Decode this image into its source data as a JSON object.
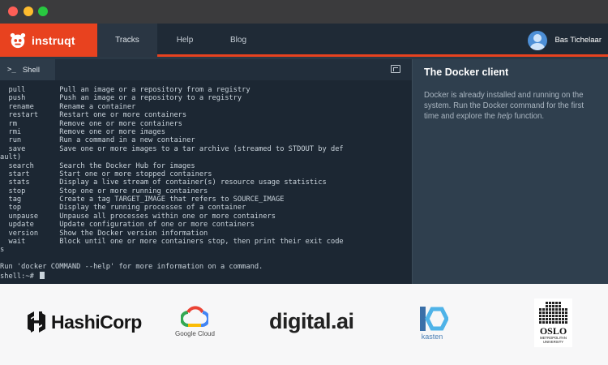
{
  "window": {
    "controls": [
      "close",
      "minimize",
      "maximize"
    ]
  },
  "navbar": {
    "brand": "instruqt",
    "tabs": [
      {
        "label": "Tracks",
        "active": true
      },
      {
        "label": "Help",
        "active": false
      },
      {
        "label": "Blog",
        "active": false
      }
    ],
    "user_name": "Bas Tichelaar",
    "accent_color": "#e8421f"
  },
  "shell": {
    "tab_label": "Shell",
    "prompt_glyph": ">_",
    "lines": [
      "  pull        Pull an image or a repository from a registry",
      "  push        Push an image or a repository to a registry",
      "  rename      Rename a container",
      "  restart     Restart one or more containers",
      "  rm          Remove one or more containers",
      "  rmi         Remove one or more images",
      "  run         Run a command in a new container",
      "  save        Save one or more images to a tar archive (streamed to STDOUT by def",
      "ault)",
      "  search      Search the Docker Hub for images",
      "  start       Start one or more stopped containers",
      "  stats       Display a live stream of container(s) resource usage statistics",
      "  stop        Stop one or more running containers",
      "  tag         Create a tag TARGET_IMAGE that refers to SOURCE_IMAGE",
      "  top         Display the running processes of a container",
      "  unpause     Unpause all processes within one or more containers",
      "  update      Update configuration of one or more containers",
      "  version     Show the Docker version information",
      "  wait        Block until one or more containers stop, then print their exit code",
      "s",
      "",
      "Run 'docker COMMAND --help' for more information on a command."
    ],
    "prompt": "shell:~# "
  },
  "assignment": {
    "title": "The Docker client",
    "body_before": "Docker is already installed and running on the system. Run the Docker command for the first time and explore the ",
    "body_emphasis": "help",
    "body_after": " function."
  },
  "partners": {
    "hashicorp": "HashiCorp",
    "google_cloud": "Google Cloud",
    "digital_ai": "digital.ai",
    "kasten": "kasten",
    "oslo_name": "OSLO",
    "oslo_sub": "METROPOLITAN UNIVERSITY"
  }
}
